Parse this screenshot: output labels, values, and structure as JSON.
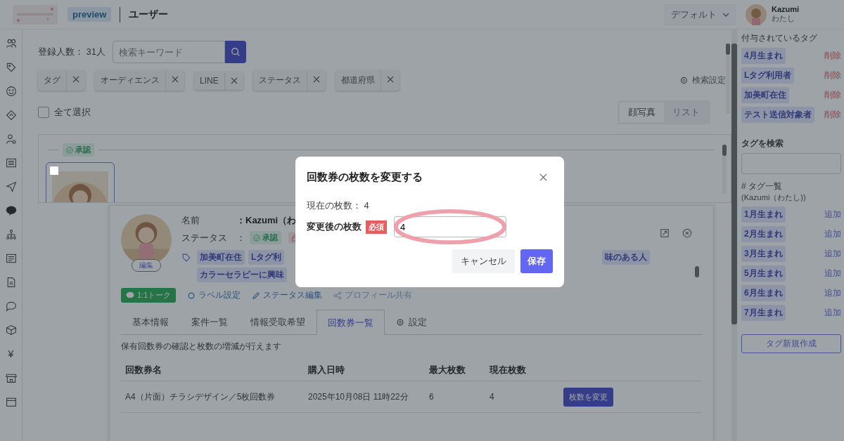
{
  "header": {
    "badge": "preview",
    "title": "ユーザー",
    "view_select": "デフォルト",
    "user": {
      "name": "Kazumi",
      "subtitle": "わたし"
    }
  },
  "nav": [
    {
      "kind": "people"
    },
    {
      "kind": "tag"
    },
    {
      "kind": "smile"
    },
    {
      "kind": "diamond"
    },
    {
      "kind": "person"
    },
    {
      "kind": "list"
    },
    {
      "kind": "send"
    },
    {
      "kind": "bubble"
    },
    {
      "kind": "sitemap"
    },
    {
      "kind": "news"
    },
    {
      "kind": "document"
    },
    {
      "kind": "chat"
    },
    {
      "kind": "box"
    },
    {
      "kind": "glyph",
      "glyph": "¥"
    },
    {
      "kind": "store"
    },
    {
      "kind": "calendar"
    }
  ],
  "users": {
    "count": "登録人数： 31人",
    "search": {
      "placeholder": "検索キーワード"
    },
    "filters": [
      "タグ",
      "オーディエンス",
      "LINE",
      "ステータス",
      "都道府県"
    ],
    "search_settings": "検索設定",
    "select_all": {
      "label": "全て選択",
      "checked": false
    },
    "view_modes": [
      {
        "label": "顔写真",
        "selected": true
      },
      {
        "label": "リスト",
        "selected": false
      }
    ],
    "group_status": "承認",
    "card": {
      "checked": false
    }
  },
  "profile": {
    "edit": "編集",
    "name_label": "名前",
    "name_value": "：Kazumi（わ",
    "status_label": "ステータス",
    "status_sep": "：",
    "status_badge": "承認",
    "tags": [
      "加美町在住",
      "Lタグ利"
    ],
    "tag_right": "味のある人",
    "tags_row2": [
      "カラーセラピーに興味"
    ],
    "talk": "1:1トーク",
    "links": [
      {
        "kind": "gear",
        "label": "ラベル設定"
      },
      {
        "kind": "pencil",
        "label": "ステータス編集"
      },
      {
        "kind": "share",
        "label": "プロフィール共有"
      }
    ],
    "tabs": [
      {
        "label": "基本情報",
        "selected": false
      },
      {
        "label": "案件一覧",
        "selected": false
      },
      {
        "label": "情報受取希望",
        "selected": false
      },
      {
        "label": "回数券一覧",
        "selected": true
      },
      {
        "label": "設定",
        "selected": false,
        "kind": "gear"
      }
    ],
    "description": "保有回数券の確認と枚数の増減が行えます",
    "table": {
      "columns": [
        "回数券名",
        "購入日時",
        "最大枚数",
        "現在枚数"
      ],
      "rows": [
        {
          "cells": [
            "A4（片面）チラシデザイン／5枚回数券",
            "2025年10月08日 11時22分",
            "6",
            "4"
          ],
          "action": "枚数を変更"
        }
      ]
    }
  },
  "modal": {
    "title": "回数券の枚数を変更する",
    "current": "現在の枚数： 4",
    "field_label": "変更後の枚数",
    "required": "必須",
    "value": "4",
    "highlighted": true,
    "cancel": "キャンセル",
    "save": "保存"
  },
  "tag_panel": {
    "assigned_title": "付与されているタグ",
    "assigned": [
      {
        "label": "4月生まれ",
        "action": "削除"
      },
      {
        "label": "Lタグ利用者",
        "action": "削除"
      },
      {
        "label": "加美町在住",
        "action": "削除"
      },
      {
        "label": "テスト送信対象者",
        "action": "削除"
      }
    ],
    "search_title": "タグを検索",
    "list_title": "# タグ一覧",
    "list_owner": "(Kazumi（わたし))",
    "tags": [
      {
        "label": "1月生まれ",
        "action": "追加"
      },
      {
        "label": "2月生まれ",
        "action": "追加"
      },
      {
        "label": "3月生まれ",
        "action": "追加"
      },
      {
        "label": "5月生まれ",
        "action": "追加"
      },
      {
        "label": "6月生まれ",
        "action": "追加"
      },
      {
        "label": "7月生まれ",
        "action": "追加"
      }
    ],
    "create": "タグ新規作成"
  }
}
